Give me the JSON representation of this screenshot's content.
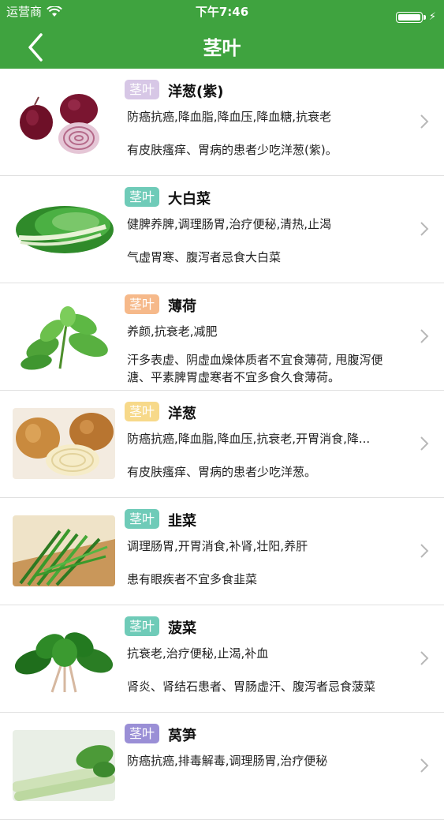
{
  "status_bar": {
    "carrier": "运营商",
    "time": "下午7:46"
  },
  "header": {
    "title": "茎叶"
  },
  "colors": {
    "nav_green": "#3fa33f"
  },
  "items": [
    {
      "tag": "茎叶",
      "tag_color": "#d7c7e6",
      "name": "洋葱(紫)",
      "effect": "防癌抗癌,降血脂,降血压,降血糖,抗衰老",
      "warning": "有皮肤瘙痒、胃病的患者少吃洋葱(紫)。",
      "image": "purple-onion"
    },
    {
      "tag": "茎叶",
      "tag_color": "#6fcbb8",
      "name": "大白菜",
      "effect": "健脾养脾,调理肠胃,治疗便秘,清热,止渴",
      "warning": "气虚胃寒、腹泻者忌食大白菜",
      "image": "napa-cabbage"
    },
    {
      "tag": "茎叶",
      "tag_color": "#f6b98a",
      "name": "薄荷",
      "effect": "养颜,抗衰老,减肥",
      "warning": "汗多表虚、阴虚血燥体质者不宜食薄荷, 甩腹泻便溏、平素脾胃虚寒者不宜多食久食薄荷。",
      "image": "mint"
    },
    {
      "tag": "茎叶",
      "tag_color": "#f7d98a",
      "name": "洋葱",
      "effect": "防癌抗癌,降血脂,降血压,抗衰老,开胃消食,降...",
      "warning": "有皮肤瘙痒、胃病的患者少吃洋葱。",
      "image": "onion"
    },
    {
      "tag": "茎叶",
      "tag_color": "#6fcbb8",
      "name": "韭菜",
      "effect": "调理肠胃,开胃消食,补肾,壮阳,养肝",
      "warning": "患有眼疾者不宜多食韭菜",
      "image": "chives"
    },
    {
      "tag": "茎叶",
      "tag_color": "#6fcbb8",
      "name": "菠菜",
      "effect": "抗衰老,治疗便秘,止渴,补血",
      "warning": "肾炎、肾结石患者、胃肠虚汗、腹泻者忌食菠菜",
      "image": "spinach"
    },
    {
      "tag": "茎叶",
      "tag_color": "#9a8fd6",
      "name": "莴笋",
      "effect": "防癌抗癌,排毒解毒,调理肠胃,治疗便秘",
      "warning": "",
      "image": "lettuce-stem"
    }
  ]
}
